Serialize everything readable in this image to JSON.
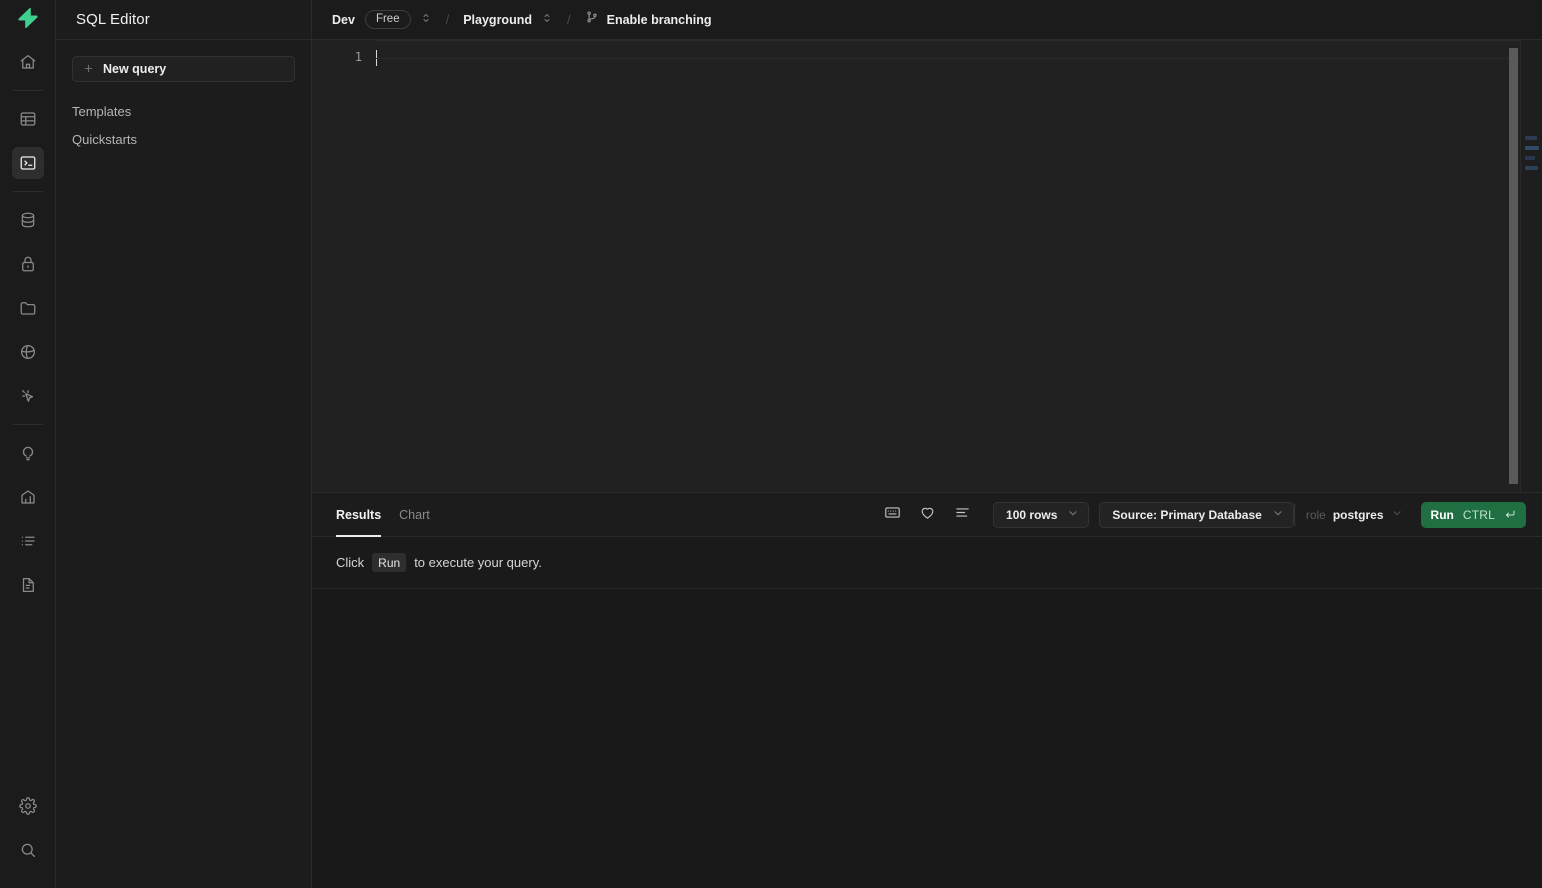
{
  "brand": {
    "logo_icon": "supabase-lightning-logo",
    "accent_green": "#3ecf8e",
    "run_green": "#1f6f43"
  },
  "rail": {
    "items": [
      {
        "icon": "home-icon",
        "name": "home",
        "active": false
      },
      {
        "icon": "table-editor-icon",
        "name": "table-editor",
        "active": false
      },
      {
        "icon": "sql-editor-icon",
        "name": "sql-editor",
        "active": true
      },
      {
        "icon": "database-icon",
        "name": "database",
        "active": false
      },
      {
        "icon": "authentication-lock-icon",
        "name": "authentication",
        "active": false
      },
      {
        "icon": "storage-folder-icon",
        "name": "storage",
        "active": false
      },
      {
        "icon": "edge-functions-icon",
        "name": "edge-functions",
        "active": false
      },
      {
        "icon": "realtime-cursor-icon",
        "name": "realtime",
        "active": false
      },
      {
        "icon": "advisors-lightbulb-icon",
        "name": "advisors",
        "active": false
      },
      {
        "icon": "reports-chart-icon",
        "name": "reports",
        "active": false
      },
      {
        "icon": "logs-list-icon",
        "name": "logs",
        "active": false
      },
      {
        "icon": "api-docs-document-icon",
        "name": "api-docs",
        "active": false
      }
    ],
    "bottom_items": [
      {
        "icon": "gear-icon",
        "name": "project-settings"
      },
      {
        "icon": "search-icon",
        "name": "search"
      }
    ]
  },
  "sidebar": {
    "title": "SQL Editor",
    "new_query_label": "New query",
    "new_query_icon": "plus-icon",
    "links": [
      {
        "label": "Templates"
      },
      {
        "label": "Quickstarts"
      }
    ]
  },
  "topbar": {
    "org_label": "Dev",
    "plan_badge": "Free",
    "org_chevron_icon": "chevron-up-down-icon",
    "separator": "/",
    "project_label": "Playground",
    "project_chevron_icon": "chevron-up-down-icon",
    "branch_icon": "git-branch-icon",
    "branch_label": "Enable branching"
  },
  "editor": {
    "line_numbers": [
      "1"
    ],
    "content": "",
    "cursor_visible": true
  },
  "results": {
    "tabs": [
      {
        "label": "Results",
        "active": true
      },
      {
        "label": "Chart",
        "active": false
      }
    ],
    "icon_buttons": [
      {
        "icon": "keyboard-shortcuts-icon",
        "name": "keyboard-shortcuts"
      },
      {
        "icon": "heart-favorite-icon",
        "name": "favorite-query"
      },
      {
        "icon": "format-lines-icon",
        "name": "format-query"
      }
    ],
    "rows_limit": "100 rows",
    "rows_limit_chevron": "chevron-down-icon",
    "source_label": "Source: Primary Database",
    "source_chevron": "chevron-down-icon",
    "role_prefix": "role",
    "role_value": "postgres",
    "role_chevron": "chevron-down-icon",
    "run_label": "Run",
    "run_shortcut": "CTRL",
    "run_shortcut_icon": "enter-return-icon",
    "message_prefix": "Click",
    "message_chip": "Run",
    "message_suffix": "to execute your query."
  }
}
